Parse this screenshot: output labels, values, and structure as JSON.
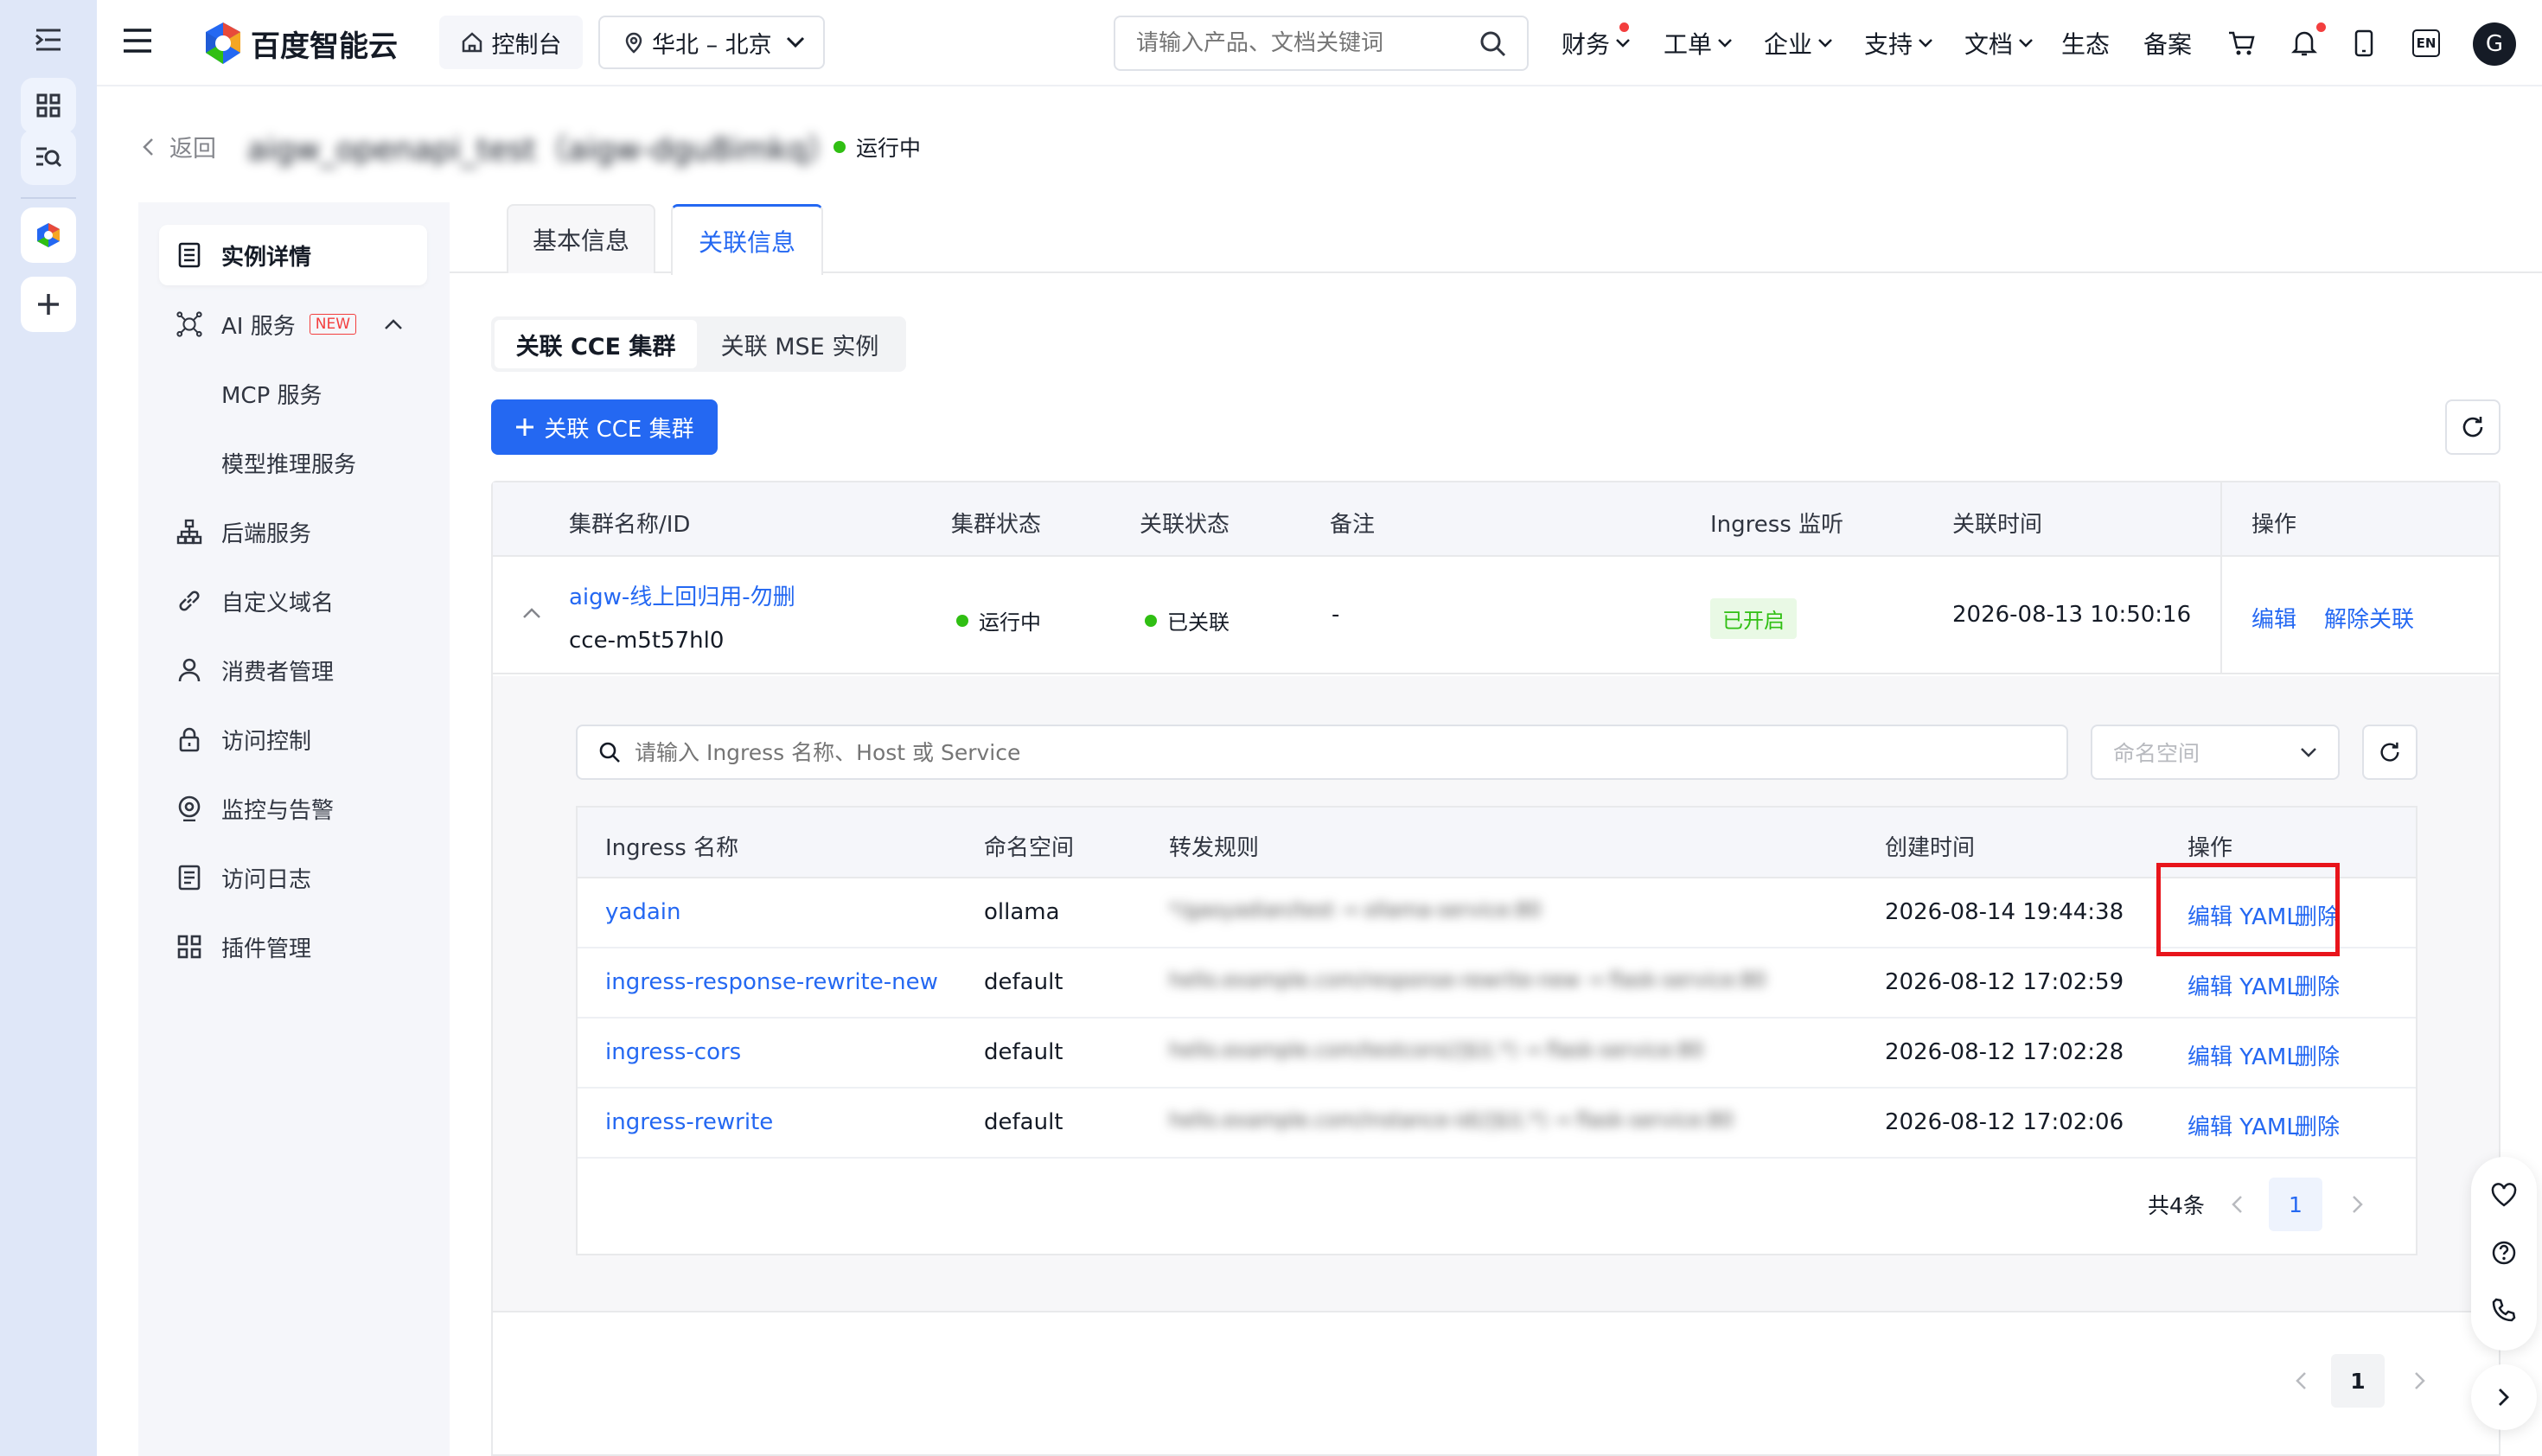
{
  "header": {
    "brand": "百度智能云",
    "console": "控制台",
    "region": "华北 – 北京",
    "search_placeholder": "请输入产品、文档关键词",
    "nav": [
      "财务",
      "工单",
      "企业",
      "支持",
      "文档",
      "生态",
      "备案"
    ],
    "lang_badge": "EN",
    "avatar_letter": "G"
  },
  "page": {
    "back_label": "返回",
    "instance_title": "aigw_openapi_test（aigw-dgu8imkq）",
    "status": "运行中"
  },
  "sidebar": {
    "items": [
      {
        "label": "实例详情"
      },
      {
        "label": "AI 服务",
        "badge": "NEW"
      },
      {
        "label": "MCP 服务"
      },
      {
        "label": "模型推理服务"
      },
      {
        "label": "后端服务"
      },
      {
        "label": "自定义域名"
      },
      {
        "label": "消费者管理"
      },
      {
        "label": "访问控制"
      },
      {
        "label": "监控与告警"
      },
      {
        "label": "访问日志"
      },
      {
        "label": "插件管理"
      }
    ]
  },
  "tabs": [
    "基本信息",
    "关联信息"
  ],
  "subtabs": [
    "关联 CCE 集群",
    "关联 MSE 实例"
  ],
  "add_button": "关联 CCE 集群",
  "cluster_table": {
    "headers": [
      "集群名称/ID",
      "集群状态",
      "关联状态",
      "备注",
      "Ingress 监听",
      "关联时间",
      "操作"
    ],
    "row": {
      "name": "aigw-线上回归用-勿删",
      "id": "cce-m5t57hl0",
      "cluster_status": "运行中",
      "assoc_status": "已关联",
      "remark": "-",
      "ingress_listen": "已开启",
      "time": "2026-08-13 10:50:16",
      "action_edit": "编辑",
      "action_unlink": "解除关联"
    }
  },
  "ingress": {
    "search_placeholder": "请输入 Ingress 名称、Host 或 Service",
    "namespace_placeholder": "命名空间",
    "headers": [
      "Ingress 名称",
      "命名空间",
      "转发规则",
      "创建时间",
      "操作"
    ],
    "rows": [
      {
        "name": "yadain",
        "ns": "ollama",
        "rule": "*/gaoyadian/test → ollama-service:80",
        "time": "2026-08-14 19:44:38",
        "edit": "编辑 YAML",
        "del": "删除"
      },
      {
        "name": "ingress-response-rewrite-new",
        "ns": "default",
        "rule": "hello.example.com/response-rewrite-new → flask-service:80",
        "time": "2026-08-12 17:02:59",
        "edit": "编辑 YAML",
        "del": "删除"
      },
      {
        "name": "ingress-cors",
        "ns": "default",
        "rule": "hello.example.com/testcors(/|$)(.*) → flask-service:80",
        "time": "2026-08-12 17:02:28",
        "edit": "编辑 YAML",
        "del": "删除"
      },
      {
        "name": "ingress-rewrite",
        "ns": "default",
        "rule": "hello.example.com/instance-id(/|$)(.*) → flask-service:80",
        "time": "2026-08-12 17:02:06",
        "edit": "编辑 YAML",
        "del": "删除"
      }
    ],
    "total": "共4条",
    "page": "1"
  },
  "outer_page": "1"
}
